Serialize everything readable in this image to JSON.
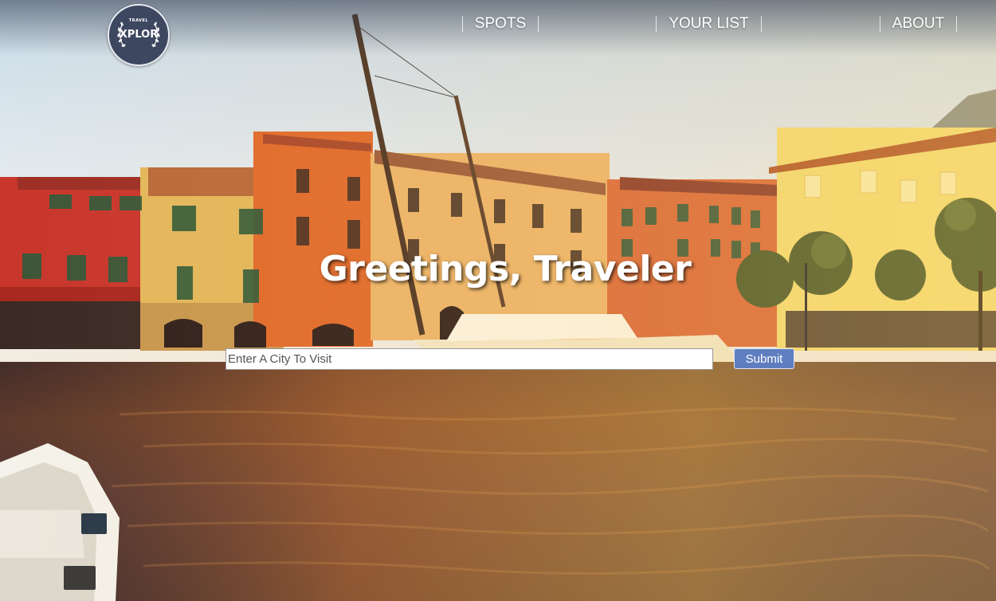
{
  "logo": {
    "top_text": "TRAVEL",
    "name": "XPLOR"
  },
  "nav": {
    "items": [
      {
        "label": "SPOTS"
      },
      {
        "label": "YOUR LIST"
      },
      {
        "label": "ABOUT"
      }
    ]
  },
  "hero": {
    "title": "Greetings, Traveler"
  },
  "search": {
    "placeholder": "Enter A City To Visit",
    "value": "",
    "submit_label": "Submit"
  },
  "colors": {
    "logo_bg": "#3d4760",
    "button_bg": "#5f7ec0",
    "text": "#ffffff"
  }
}
